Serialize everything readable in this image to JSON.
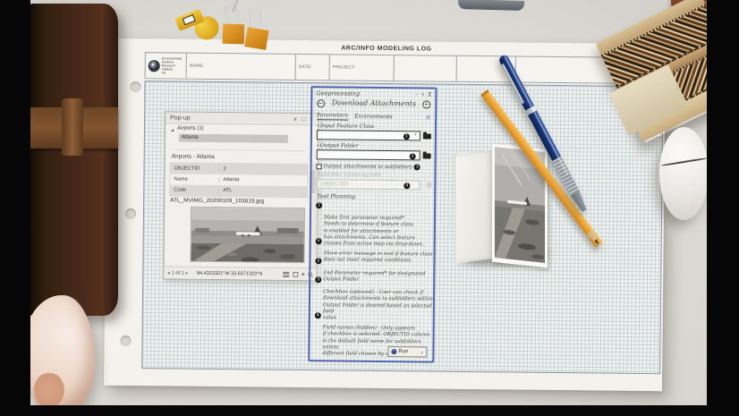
{
  "icons": {
    "collapse": "∨",
    "window": "□",
    "close": "×",
    "tree_expander": "◢",
    "prev": "◂",
    "next": "▸",
    "minimize": "–",
    "pin": "▿",
    "close_x": "X",
    "back": "←",
    "plus": "+",
    "caret": "∨",
    "gear": "⚙",
    "bullet": "•"
  },
  "log_sheet": {
    "title": "ARC/INFO MODELING LOG",
    "logo_org": "Environmental\nSystems\nResearch\nInstitute,\nInc.",
    "name_label": "NAME:",
    "date_label": "DATE:",
    "project_label": "PROJECT:"
  },
  "popup": {
    "title": "Pop-up",
    "tree_group": "Airports (1)",
    "tree_item": "Atlanta",
    "section_title": "Airports - Atlanta",
    "table": {
      "rows": [
        {
          "field": "OBJECTID",
          "value": "2"
        },
        {
          "field": "Name",
          "value": "Atlanta"
        },
        {
          "field": "Code",
          "value": "ATL"
        }
      ]
    },
    "attachment_filename": "ATL_MVIMG_20200109_103619.jpg",
    "pager": "1 of 1",
    "coordinates": "84.4323321°W  33.6371323°N"
  },
  "geoprocessing": {
    "panel_title": "Geoprocessing",
    "tool_title": "Download Attachments",
    "tabs": {
      "active": "Parameters",
      "inactive": "Environments"
    },
    "input_label": "Input Feature Class",
    "output_label": "Output Folder",
    "checkbox_label": "Output attachments to subfolders",
    "subfolder_label": "Subfolder names by field",
    "subfolder_value": "OBJECTID",
    "run_label": "Run",
    "markers": {
      "m1": "1",
      "m2": "2",
      "m3": "3",
      "m4": "4",
      "error": "×"
    },
    "notes": {
      "title": "Tool Planning",
      "n1": "Make first parameter required*\nNeeds to determine if feature class\nis enabled for attachments or\nhas attachments. Can select feature\nclasses from active map via drop-down.",
      "n1b": "Show error message in tool if feature class\ndoes not meet required conditions.",
      "n2": "2nd Parameter required* for designated\nOutput Folder",
      "n3": "Checkbox (optional) - User can check if\ndownload attachments to subfolders within\nOutput Folder is desired based on selected field\nvalue",
      "n4": "Field names (hidden) - Only appears\nif checkbox is selected. OBJECTID column\nis the default field name for subfolders unless\ndifferent field chosen by user"
    }
  }
}
